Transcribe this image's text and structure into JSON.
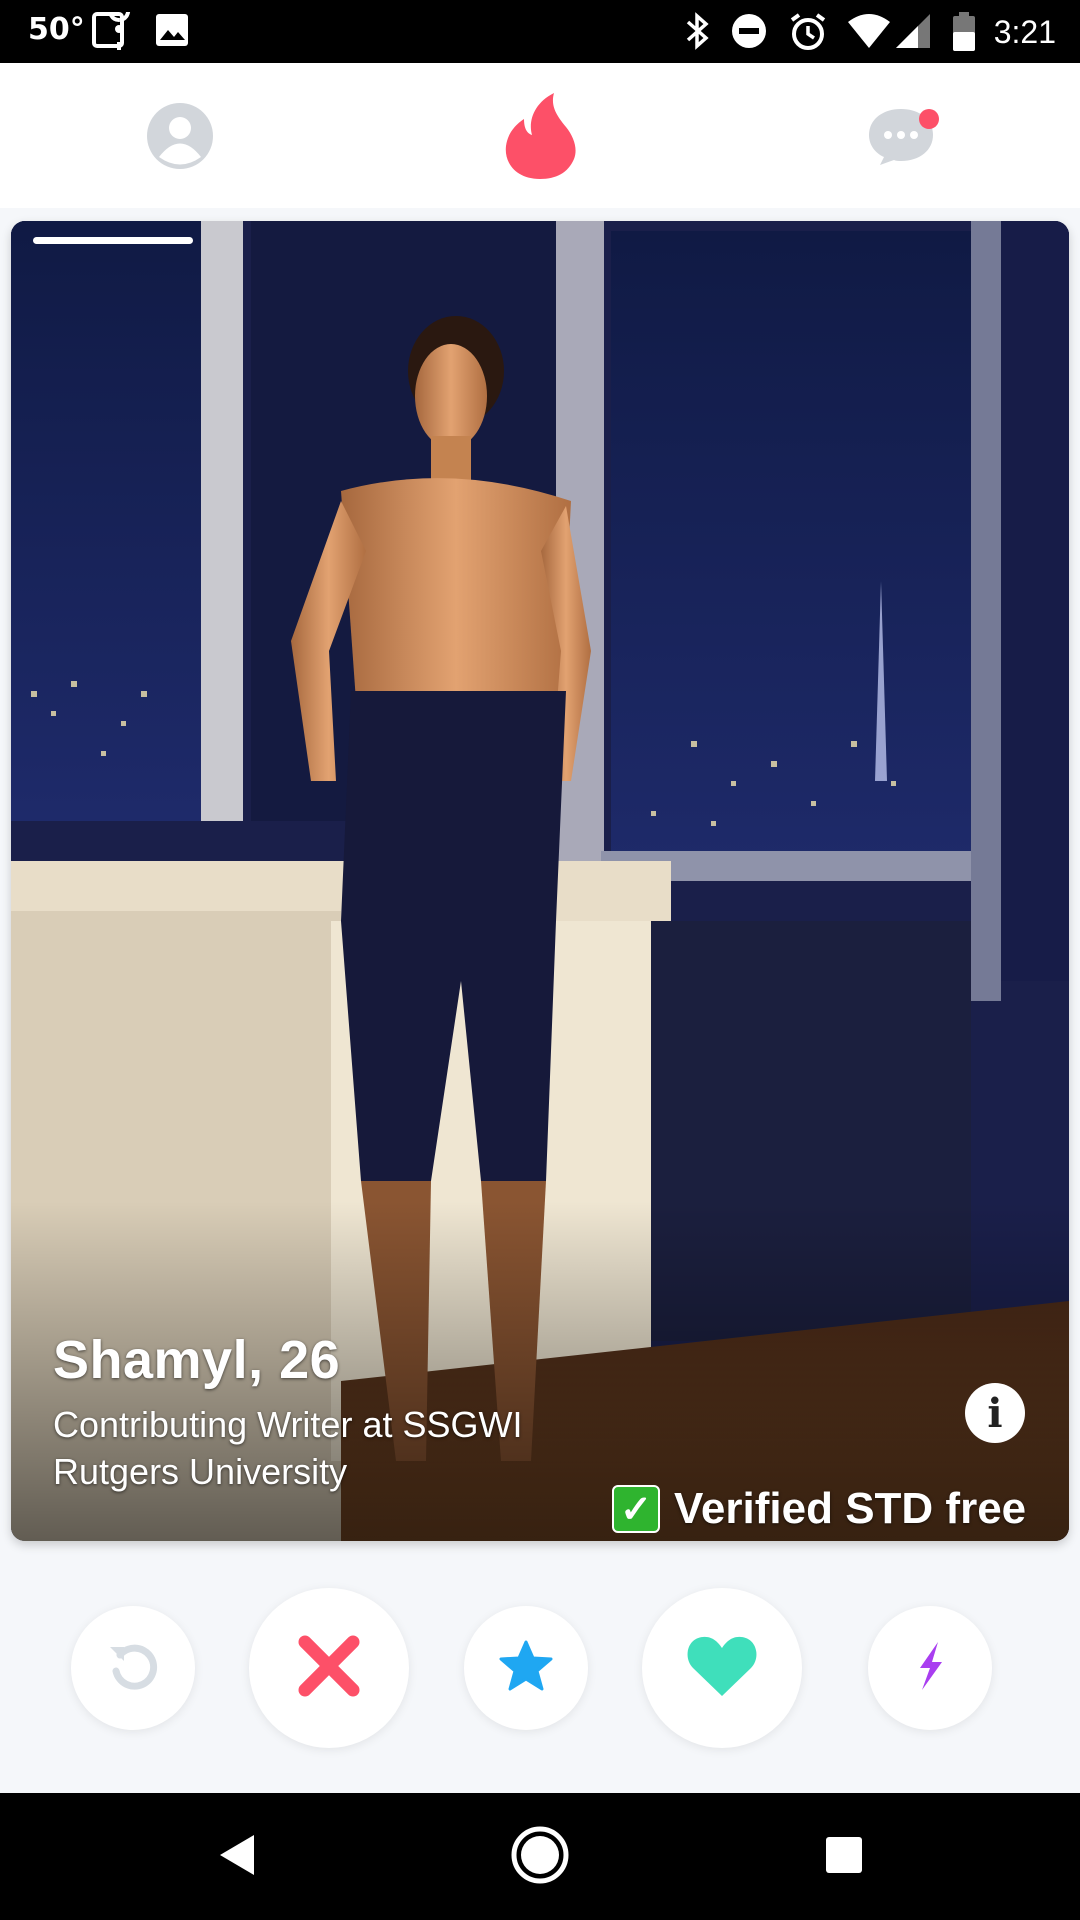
{
  "status_bar": {
    "temperature": "50°",
    "time": "3:21",
    "icons": [
      "maps-icon",
      "image-icon",
      "bluetooth-icon",
      "dnd-icon",
      "alarm-icon",
      "wifi-icon",
      "signal-icon",
      "battery-icon"
    ]
  },
  "top_nav": {
    "icons": [
      "profile-icon",
      "flame-icon",
      "chat-icon"
    ],
    "colors": {
      "flame": "#fd5068",
      "inactive": "#d2d6db",
      "notification": "#fd5068"
    }
  },
  "card": {
    "name_age": "Shamyl, 26",
    "job": "Contributing Writer at SSGWI",
    "school": "Rutgers University",
    "info_label": "i",
    "verified_check": "✓",
    "verified_text": "Verified STD free"
  },
  "actions": {
    "icons": [
      "rewind-icon",
      "nope-icon",
      "super-like-icon",
      "like-icon",
      "boost-icon"
    ],
    "colors": {
      "nope": "#fd5068",
      "super_like": "#1fa7f2",
      "like": "#3fdfbb",
      "boost": "#a93ef0",
      "rewind": "#d7dde3"
    }
  },
  "system_nav": {
    "icons": [
      "back-icon",
      "home-icon",
      "recents-icon"
    ]
  }
}
